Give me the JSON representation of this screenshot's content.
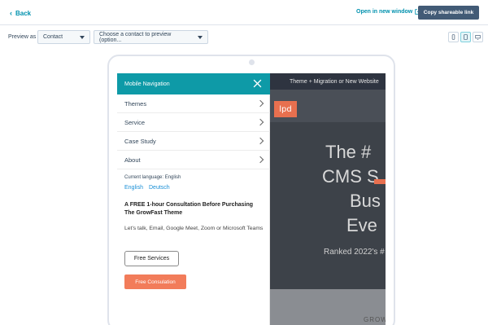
{
  "topbar": {
    "back_label": "Back",
    "open_new_window_label": "Open in new window",
    "copy_link_label": "Copy shareable link"
  },
  "preview": {
    "label": "Preview as",
    "contact_select": "Contact",
    "preview_select": "Choose a contact to preview (option..."
  },
  "devices": [
    "mobile-icon",
    "tablet-icon",
    "desktop-icon"
  ],
  "site": {
    "top_bar_text": "Theme + Migration or New Website",
    "logo_text": "lpd",
    "hero_lines": [
      "The #",
      "CMS S",
      "Bus",
      "Eve"
    ],
    "hero_sub": "Ranked 2022's #",
    "footer_text": "GROW"
  },
  "panel": {
    "title": "Mobile Navigation",
    "items": [
      {
        "label": "Themes"
      },
      {
        "label": "Service"
      },
      {
        "label": "Case Study"
      },
      {
        "label": "About"
      }
    ],
    "language_label": "Current language: English",
    "languages": [
      "English",
      "Deutsch"
    ],
    "promo_title": "A FREE 1-hour Consultation Before Purchasing The GrowFast Theme",
    "promo_text": "Let's talk, Email, Google Meet, Zoom or Microsoft Teams",
    "free_services_label": "Free Services",
    "free_consultation_label": "Free Consulation"
  },
  "colors": {
    "accent": "#0091ae",
    "panel_header": "#0e9aa7",
    "cta": "#f27c5a",
    "copy_button": "#425b76"
  }
}
